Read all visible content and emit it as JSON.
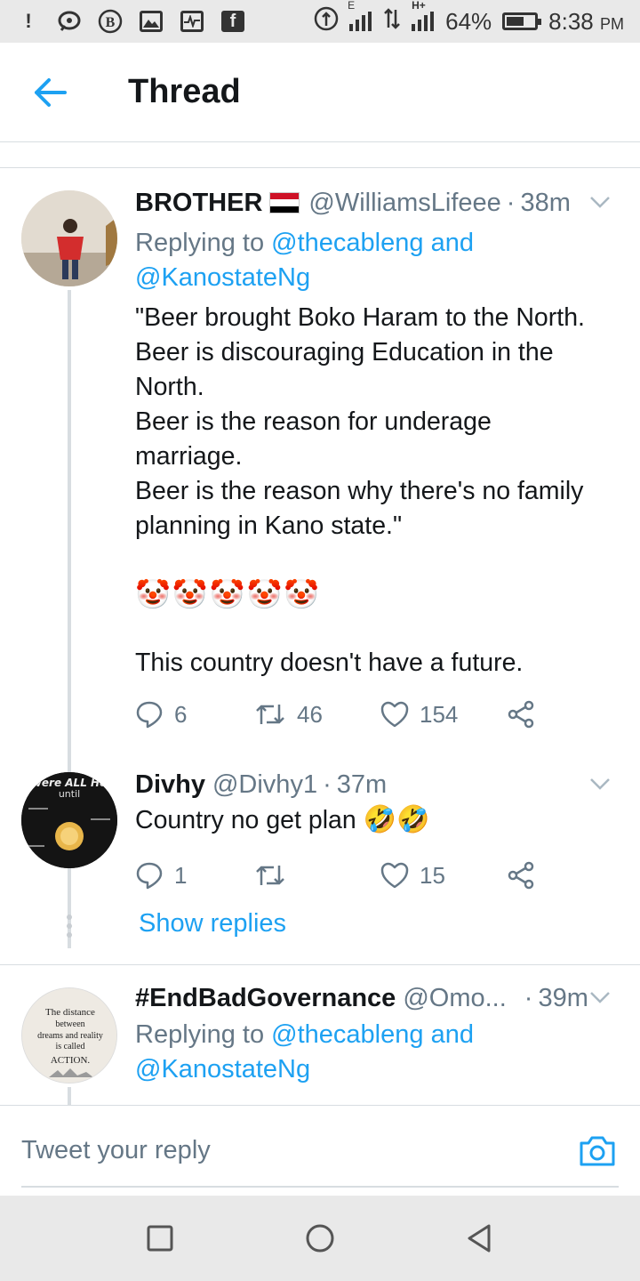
{
  "status_bar": {
    "icons_left": [
      "alert-icon",
      "chat-bubble-icon",
      "b-badge-icon",
      "image-icon",
      "activity-icon",
      "facebook-icon"
    ],
    "fb_letter": "f",
    "b_letter": "B",
    "network_e": "E",
    "network_h": "H+",
    "battery_percent": "64%",
    "battery_level": 0.64,
    "time": "8:38",
    "ampm": "PM"
  },
  "header": {
    "title": "Thread"
  },
  "tweets": [
    {
      "name": "BROTHER",
      "flag_colors": [
        "#ce1126",
        "#ffffff",
        "#000000"
      ],
      "handle": "@WilliamsLifeee",
      "sep": "·",
      "time": "38m",
      "replying_prefix": "Replying to",
      "replying_1": "@thecableng",
      "replying_and": "and",
      "replying_2": "@KanostateNg",
      "lines": [
        "\"Beer brought Boko Haram to the North.",
        "Beer is discouraging Education in the",
        "North.",
        "Beer is the reason for underage",
        "marriage.",
        "Beer is the reason why there's no family",
        "planning in Kano state.\""
      ],
      "emoji": "🤡🤡🤡🤡🤡",
      "final_line": "This country doesn't have a future.",
      "replies": "6",
      "retweets": "46",
      "likes": "154"
    },
    {
      "name": "Divhy",
      "handle": "@Divhy1",
      "sep": "·",
      "time": "37m",
      "avatar_text_1": "were ALL He",
      "avatar_text_2": "until",
      "text": "Country no get plan",
      "emoji": "🤣🤣",
      "replies": "1",
      "retweets": "",
      "likes": "15",
      "show_replies": "Show replies"
    },
    {
      "name": "#EndBadGovernance",
      "handle": "@Omo...",
      "sep": "·",
      "time": "39m",
      "avatar_lines": [
        "The distance",
        "between",
        "dreams and reality",
        "is called",
        "ACTION."
      ],
      "replying_prefix": "Replying to",
      "replying_1": "@thecableng",
      "replying_and": "and",
      "replying_2": "@KanostateNg"
    }
  ],
  "reply_bar": {
    "placeholder": "Tweet your reply"
  },
  "colors": {
    "accent": "#1da1f2",
    "secondary_text": "#657786",
    "primary_text": "#14171a",
    "divider": "#d8dde1"
  }
}
